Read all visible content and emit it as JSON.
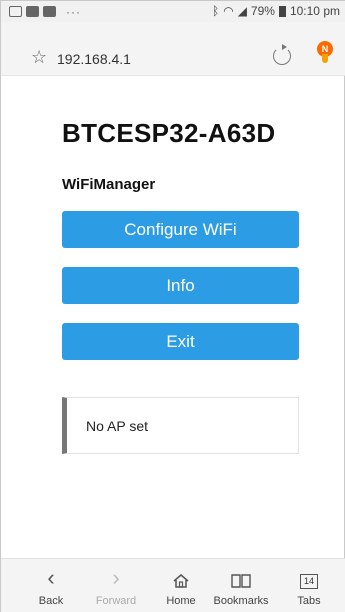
{
  "status_bar": {
    "dots": "···",
    "battery": "79%",
    "time": "10:10 pm"
  },
  "browser": {
    "url": "192.168.4.1",
    "profile_initial": "N"
  },
  "page": {
    "title": "BTCESP32-A63D",
    "subtitle": "WiFiManager",
    "buttons": {
      "configure": "Configure WiFi",
      "info": "Info",
      "exit": "Exit"
    },
    "message": "No AP set"
  },
  "bottom_nav": {
    "back": "Back",
    "forward": "Forward",
    "home": "Home",
    "bookmarks": "Bookmarks",
    "tabs": "Tabs",
    "tab_count": "14"
  },
  "colors": {
    "button": "#2c9ce5",
    "message_border": "#777777"
  }
}
